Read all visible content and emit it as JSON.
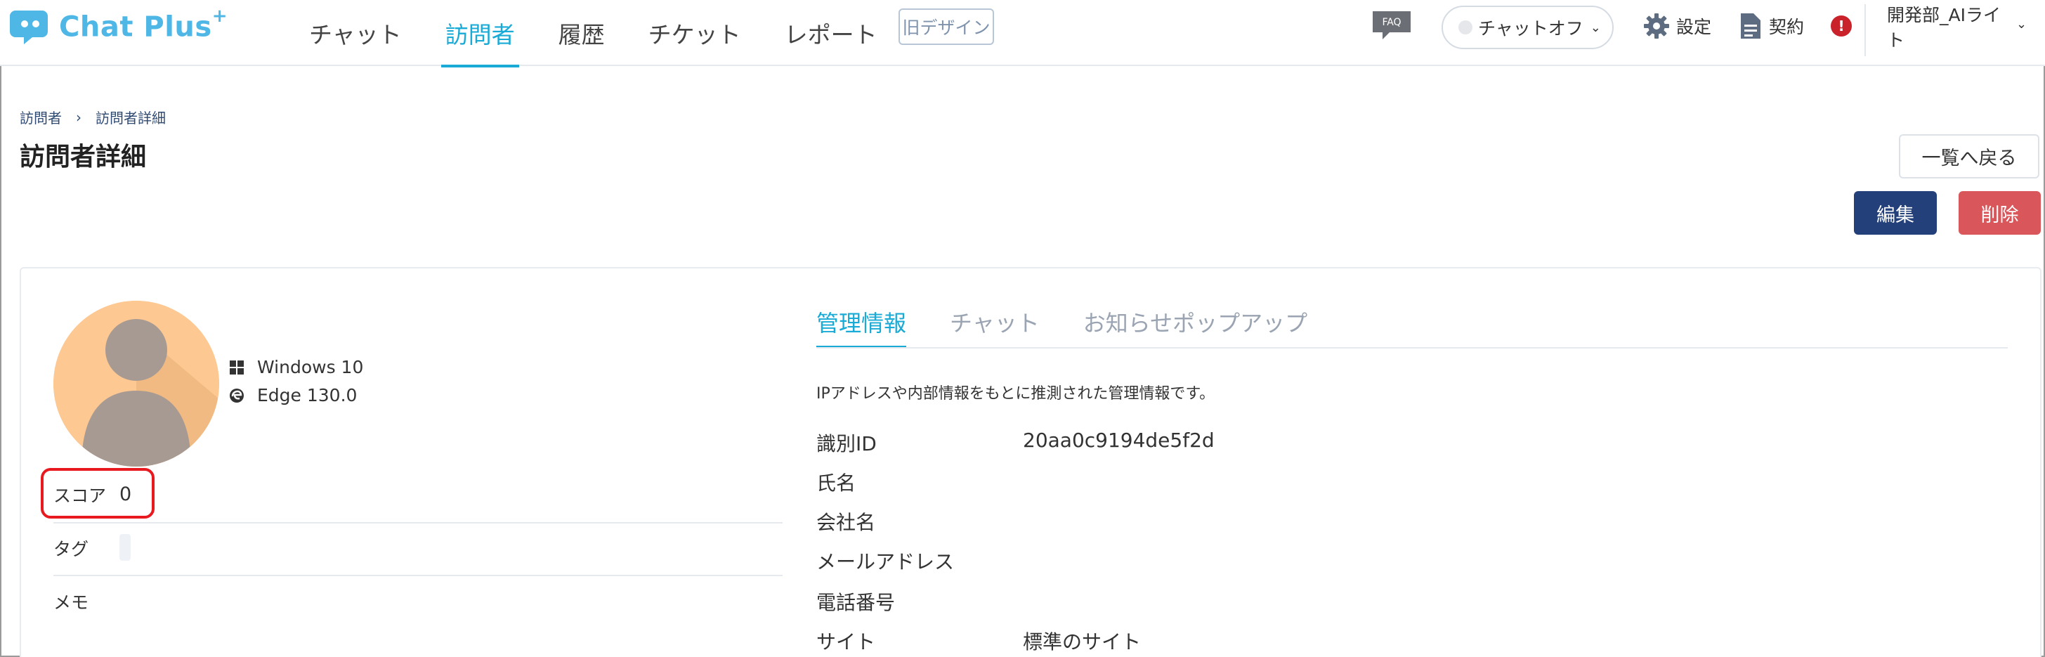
{
  "app": {
    "logo_text": "Chat Plus",
    "logo_sup": "+",
    "brand_color": "#4fb7e6"
  },
  "nav": {
    "items": [
      {
        "label": "チャット",
        "active": false
      },
      {
        "label": "訪問者",
        "active": true
      },
      {
        "label": "履歴",
        "active": false
      },
      {
        "label": "チケット",
        "active": false
      },
      {
        "label": "レポート",
        "active": false
      }
    ],
    "old_design": "旧デザイン",
    "faq": "FAQ",
    "chat_status": "チャットオフ",
    "settings": "設定",
    "contract": "契約",
    "alert_badge": "!",
    "account_line1": "開発部_AIライ",
    "account_line2": "ト",
    "accent_color": "#1aaad6"
  },
  "breadcrumb": {
    "items": [
      "訪問者",
      "訪問者詳細"
    ],
    "separator": "›"
  },
  "page": {
    "title": "訪問者詳細",
    "back_button": "一覧へ戻る",
    "edit_button": "編集",
    "delete_button": "削除",
    "edit_color": "#23407a",
    "delete_color": "#d9575b"
  },
  "visitor": {
    "os": "Windows 10",
    "browser": "Edge 130.0",
    "score_label": "スコア",
    "score_value": "0",
    "tag_label": "タグ",
    "memo_label": "メモ"
  },
  "tabs": [
    {
      "label": "管理情報",
      "active": true
    },
    {
      "label": "チャット",
      "active": false
    },
    {
      "label": "お知らせポップアップ",
      "active": false
    }
  ],
  "management": {
    "note": "IPアドレスや内部情報をもとに推測された管理情報です。",
    "rows": [
      {
        "label": "識別ID",
        "value": "20aa0c9194de5f2d"
      },
      {
        "label": "氏名",
        "value": ""
      },
      {
        "label": "会社名",
        "value": ""
      },
      {
        "label": "メールアドレス",
        "value": ""
      },
      {
        "label": "電話番号",
        "value": ""
      },
      {
        "label": "サイト",
        "value": "標準のサイト"
      }
    ]
  }
}
